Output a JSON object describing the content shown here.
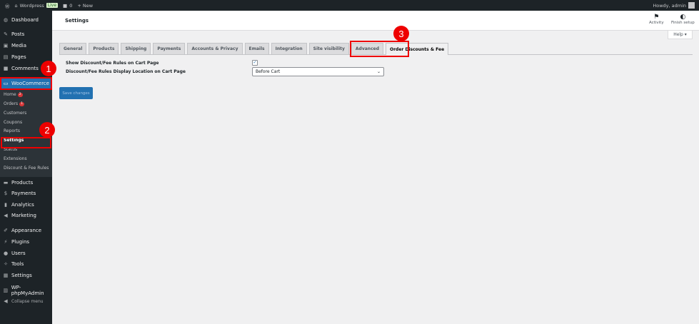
{
  "adminbar": {
    "site": "Wordpress",
    "live": "Live",
    "comments": "0",
    "new": "+ New",
    "howdy": "Howdy, admin"
  },
  "sidebar": {
    "top": [
      {
        "label": "Dashboard",
        "icon": "◍"
      },
      {
        "label": "Posts",
        "icon": "✎"
      },
      {
        "label": "Media",
        "icon": "▣"
      },
      {
        "label": "Pages",
        "icon": "▤"
      },
      {
        "label": "Comments",
        "icon": "■"
      }
    ],
    "woocommerce": "WooCommerce",
    "sub": [
      {
        "label": "Home",
        "badge": "2"
      },
      {
        "label": "Orders",
        "badge": "1"
      },
      {
        "label": "Customers"
      },
      {
        "label": "Coupons"
      },
      {
        "label": "Reports"
      },
      {
        "label": "Settings"
      },
      {
        "label": "Status"
      },
      {
        "label": "Extensions"
      },
      {
        "label": "Discount & Fee Rules"
      }
    ],
    "bottom": [
      {
        "label": "Products",
        "icon": "▬"
      },
      {
        "label": "Payments",
        "icon": "$"
      },
      {
        "label": "Analytics",
        "icon": "▮"
      },
      {
        "label": "Marketing",
        "icon": "◀"
      },
      {
        "label": "Appearance",
        "icon": "✐"
      },
      {
        "label": "Plugins",
        "icon": "⚡"
      },
      {
        "label": "Users",
        "icon": "●"
      },
      {
        "label": "Tools",
        "icon": "✧"
      },
      {
        "label": "Settings",
        "icon": "▦"
      },
      {
        "label": "WP-phpMyAdmin",
        "icon": "▥"
      },
      {
        "label": "Collapse menu",
        "icon": "◀"
      }
    ]
  },
  "header": {
    "title": "Settings",
    "activity": "Activity",
    "finish": "Finish setup",
    "help": "Help ▾"
  },
  "tabs": [
    "General",
    "Products",
    "Shipping",
    "Payments",
    "Accounts & Privacy",
    "Emails",
    "Integration",
    "Site visibility",
    "Advanced",
    "Order Discounts & Fee"
  ],
  "form": {
    "show_label": "Show Discount/Fee Rules on Cart Page",
    "show_checked": true,
    "location_label": "Discount/Fee Rules Display Location on Cart Page",
    "location_value": "Before Cart",
    "save": "Save changes"
  },
  "annotations": [
    "1",
    "2",
    "3"
  ]
}
